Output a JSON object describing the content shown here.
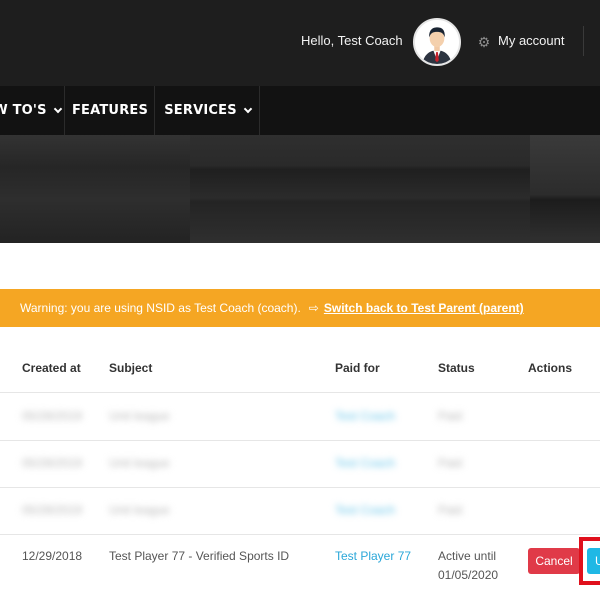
{
  "header": {
    "greeting": "Hello, Test Coach",
    "avatar_icon": "user-avatar-icon",
    "gear_icon": "gear-icon",
    "account_label": "My account"
  },
  "nav": {
    "items": [
      {
        "label": "W TO'S",
        "has_dropdown": true
      },
      {
        "label": "FEATURES",
        "has_dropdown": false
      },
      {
        "label": "SERVICES",
        "has_dropdown": true
      }
    ]
  },
  "warning": {
    "text": "Warning: you are using NSID as Test Coach (coach).",
    "switch_icon": "switch-user-icon",
    "switch_link": "Switch back to Test Parent (parent)",
    "color": "#f5a623"
  },
  "table": {
    "headers": {
      "created_at": "Created at",
      "subject": "Subject",
      "paid_for": "Paid for",
      "status": "Status",
      "actions": "Actions"
    },
    "blurred_rows": [
      {
        "created_at": "05/28/2019",
        "subject": "Unit league",
        "paid_for": "Test Coach",
        "status": "Paid"
      },
      {
        "created_at": "05/28/2019",
        "subject": "Unit league",
        "paid_for": "Test Coach",
        "status": "Paid"
      },
      {
        "created_at": "05/28/2019",
        "subject": "Unit league",
        "paid_for": "Test Coach",
        "status": "Paid"
      }
    ],
    "row": {
      "created_at": "12/29/2018",
      "subject": "Test Player 77 - Verified Sports ID",
      "paid_for": "Test Player 77",
      "status_line1": "Active until",
      "status_line2": "01/05/2020",
      "cancel_label": "Cancel",
      "update_label": "U"
    }
  },
  "colors": {
    "topbar": "#1e1e1e",
    "navbar": "#121212",
    "link": "#2aa7d9",
    "cancel": "#e03a48",
    "update": "#1fb8e5",
    "highlight": "#e0101c"
  }
}
